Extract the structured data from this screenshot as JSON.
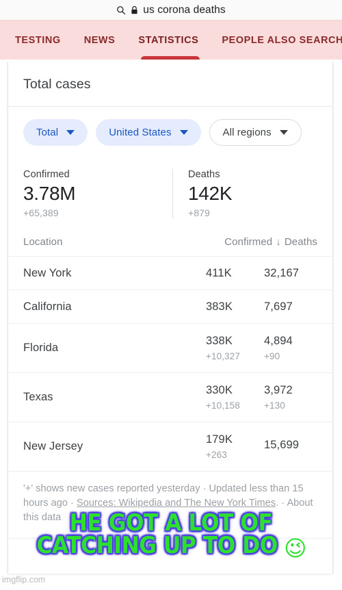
{
  "search": {
    "query": "us corona deaths",
    "search_icon": "search-icon",
    "lock_icon": "lock-icon"
  },
  "tabs": {
    "items": [
      {
        "label": "TESTING",
        "active": false
      },
      {
        "label": "NEWS",
        "active": false
      },
      {
        "label": "STATISTICS",
        "active": true
      },
      {
        "label": "PEOPLE ALSO SEARCHED FOR",
        "active": false
      }
    ],
    "active_index": 2,
    "bg_color": "#fadcdc",
    "text_color": "#8a2a2a",
    "indicator_color": "#c7353a"
  },
  "card": {
    "title": "Total cases",
    "chips": [
      {
        "label": "Total",
        "style": "filled"
      },
      {
        "label": "United States",
        "style": "filled"
      },
      {
        "label": "All regions",
        "style": "outline"
      }
    ],
    "chip_accent": "#1a56c4",
    "chip_fill": "#e4ecfd",
    "totals": [
      {
        "label": "Confirmed",
        "value": "3.78M",
        "delta": "+65,389"
      },
      {
        "label": "Deaths",
        "value": "142K",
        "delta": "+879"
      }
    ],
    "table": {
      "headers": {
        "location": "Location",
        "confirmed": "Confirmed",
        "sort_arrow": "↓",
        "deaths": "Deaths"
      },
      "rows": [
        {
          "location": "New York",
          "confirmed": "411K",
          "confirmed_delta": "",
          "deaths": "32,167",
          "deaths_delta": ""
        },
        {
          "location": "California",
          "confirmed": "383K",
          "confirmed_delta": "",
          "deaths": "7,697",
          "deaths_delta": ""
        },
        {
          "location": "Florida",
          "confirmed": "338K",
          "confirmed_delta": "+10,327",
          "deaths": "4,894",
          "deaths_delta": "+90"
        },
        {
          "location": "Texas",
          "confirmed": "330K",
          "confirmed_delta": "+10,158",
          "deaths": "3,972",
          "deaths_delta": "+130"
        },
        {
          "location": "New Jersey",
          "confirmed": "179K",
          "confirmed_delta": "+263",
          "deaths": "15,699",
          "deaths_delta": ""
        }
      ]
    },
    "footnote": {
      "part1": "'+' shows new cases reported yesterday · Updated less than 15 hours ago · ",
      "sources_label": "Sources: Wikipedia and The New York Times",
      "part2": ". · ",
      "trailing": "About this data"
    }
  },
  "meme": {
    "line1": "HE GOT A LOT OF",
    "line2": "CATCHING UP TO DO",
    "emoji": "😉",
    "text_color": "#2ee02e",
    "outline_color": "#4040ff",
    "watermark": "imgflip.com"
  }
}
